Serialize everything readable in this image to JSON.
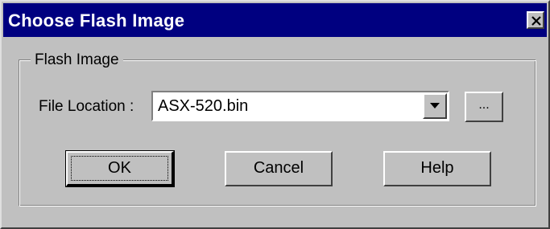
{
  "dialog": {
    "title": "Choose Flash Image",
    "close_icon": "close-icon"
  },
  "group": {
    "label": "Flash Image"
  },
  "file_location": {
    "label": "File Location :",
    "value": "ASX-520.bin",
    "dropdown_icon": "chevron-down-icon",
    "browse_label": "..."
  },
  "buttons": {
    "ok": "OK",
    "cancel": "Cancel",
    "help": "Help"
  },
  "colors": {
    "titlebar": "#000080",
    "face": "#c0c0c0"
  }
}
